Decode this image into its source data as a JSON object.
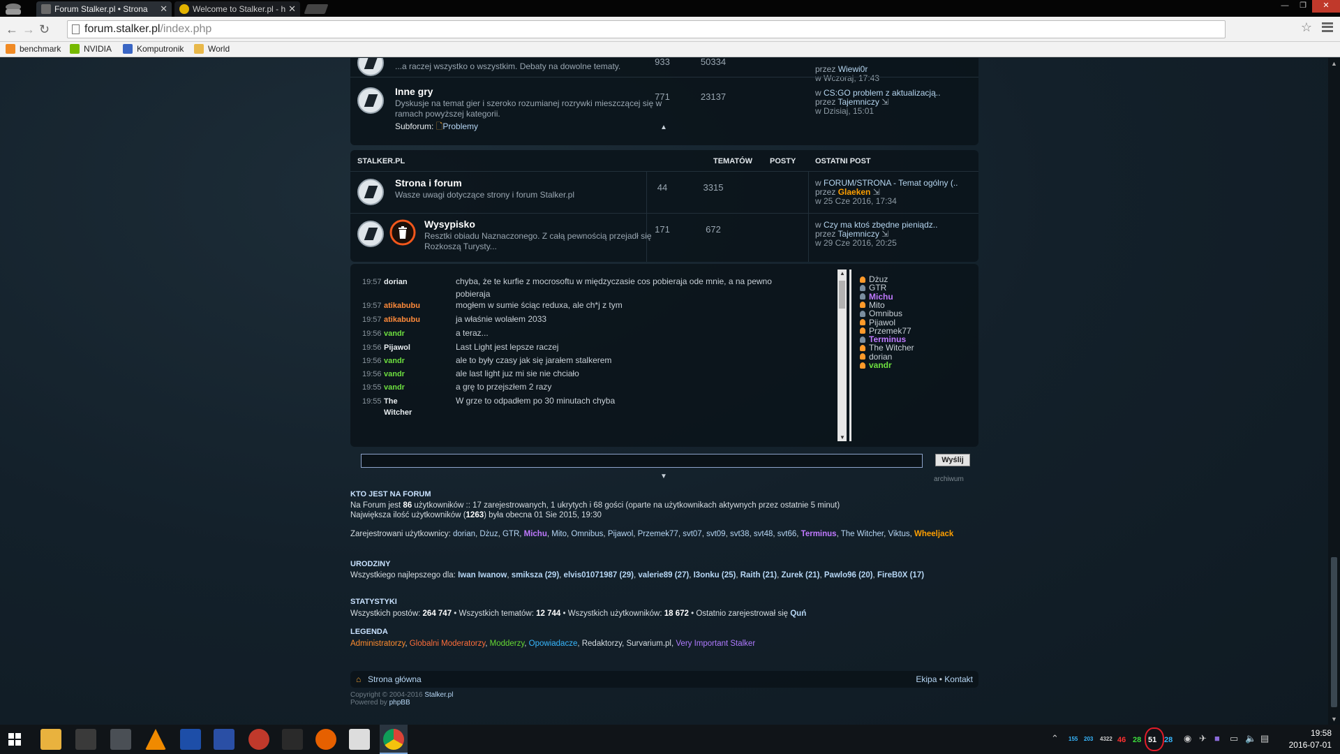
{
  "browser": {
    "tabs": [
      {
        "title": "Forum Stalker.pl • Strona",
        "active": true
      },
      {
        "title": "Welcome to Stalker.pl - h",
        "active": false
      }
    ],
    "url_host": "forum.stalker.pl",
    "url_path": "/index.php",
    "bookmarks": [
      "benchmark",
      "NVIDIA",
      "Komputronik",
      "World"
    ]
  },
  "forum": {
    "top_partial": {
      "desc": "...a raczej wszystko o wszystkim. Debaty na dowolne tematy.",
      "topics": "933",
      "posts": "50334",
      "last_by_label": "przez",
      "last_author": "Wiewi0r",
      "last_date": "w Wczoraj, 17:43"
    },
    "inne_gry": {
      "title": "Inne gry",
      "desc": "Dyskusje na temat gier i szeroko rozumianej rozrywki mieszczącej się w ramach powyższej kategorii.",
      "subforum_label": "Subforum:",
      "subforum_link": "Problemy",
      "topics": "771",
      "posts": "23137",
      "last_in": "w",
      "last_topic": "CS:GO problem z aktualizacją..",
      "last_by_label": "przez",
      "last_author": "Tajemniczy",
      "last_date": "w Dzisiaj, 15:01"
    },
    "section": {
      "name": "STALKER.PL",
      "col_topics": "TEMATÓW",
      "col_posts": "POSTY",
      "col_last": "OSTATNI POST"
    },
    "strona": {
      "title": "Strona i forum",
      "desc": "Wasze uwagi dotyczące strony i forum Stalker.pl",
      "topics": "44",
      "posts": "3315",
      "last_in": "w",
      "last_topic": "FORUM/STRONA - Temat ogólny (..",
      "last_by_label": "przez",
      "last_author": "Glaeken",
      "last_date": "w 25 Cze 2016, 17:34"
    },
    "wysypisko": {
      "title": "Wysypisko",
      "desc": "Resztki obiadu Naznaczonego. Z całą pewnością przejadł się Rozkoszą Turysty...",
      "topics": "171",
      "posts": "672",
      "last_in": "w",
      "last_topic": "Czy ma ktoś zbędne pieniądz..",
      "last_by_label": "przez",
      "last_author": "Tajemniczy",
      "last_date": "w 29 Cze 2016, 20:25"
    }
  },
  "chat": {
    "messages": [
      {
        "time": "19:57",
        "nick": "dorian",
        "cls": "nick-white",
        "text": "chyba, że te kurfie z mocrosoftu w międzyczasie cos pobieraja ode mnie, a na pewno pobieraja"
      },
      {
        "time": "19:57",
        "nick": "atikabubu",
        "cls": "nick-orange",
        "text": "mogłem w sumie ściąc reduxa, ale ch*j z tym"
      },
      {
        "time": "19:57",
        "nick": "atikabubu",
        "cls": "nick-orange",
        "text": "ja właśnie wolałem 2033"
      },
      {
        "time": "19:56",
        "nick": "vandr",
        "cls": "nick-green",
        "text": "a teraz..."
      },
      {
        "time": "19:56",
        "nick": "Pijawol",
        "cls": "nick-white",
        "text": "Last Light jest lepsze raczej"
      },
      {
        "time": "19:56",
        "nick": "vandr",
        "cls": "nick-green",
        "text": "ale to były czasy jak się jarałem stalkerem"
      },
      {
        "time": "19:56",
        "nick": "vandr",
        "cls": "nick-green",
        "text": "ale last light juz mi sie nie chciało"
      },
      {
        "time": "19:55",
        "nick": "vandr",
        "cls": "nick-green",
        "text": "a grę to przejszłem 2 razy"
      },
      {
        "time": "19:55",
        "nick": "The Witcher",
        "cls": "nick-white",
        "text": "W grze to odpadłem po 30 minutach chyba"
      }
    ],
    "online": [
      {
        "name": "Dżuz",
        "color": "#c8d0d7",
        "dot": "#ff9a2a",
        "bold": false
      },
      {
        "name": "GTR",
        "color": "#c8d0d7",
        "dot": "#7a8ea0",
        "bold": false
      },
      {
        "name": "Michu",
        "color": "#c079ff",
        "dot": "#7a8ea0",
        "bold": true
      },
      {
        "name": "Mito",
        "color": "#c8d0d7",
        "dot": "#ff9a2a",
        "bold": false
      },
      {
        "name": "Omnibus",
        "color": "#c8d0d7",
        "dot": "#7a8ea0",
        "bold": false
      },
      {
        "name": "Pijawol",
        "color": "#c8d0d7",
        "dot": "#ff9a2a",
        "bold": false
      },
      {
        "name": "Przemek77",
        "color": "#c8d0d7",
        "dot": "#ff9a2a",
        "bold": false
      },
      {
        "name": "Terminus",
        "color": "#c079ff",
        "dot": "#7a8ea0",
        "bold": true
      },
      {
        "name": "The Witcher",
        "color": "#c8d0d7",
        "dot": "#ff9a2a",
        "bold": false
      },
      {
        "name": "dorian",
        "color": "#c8d0d7",
        "dot": "#ff9a2a",
        "bold": false
      },
      {
        "name": "vandr",
        "color": "#6ddf3f",
        "dot": "#ff9a2a",
        "bold": true
      }
    ],
    "send_label": "Wyślij",
    "archive_label": "archiwum"
  },
  "who": {
    "head": "KTO JEST NA FORUM",
    "line1_a": "Na Forum jest ",
    "line1_count": "86",
    "line1_b": " użytkowników :: 17 zarejestrowanych, 1 ukrytych i 68 gości (oparte na użytkownikach aktywnych przez ostatnie 5 minut)",
    "line2_a": "Największa ilość użytkowników (",
    "line2_count": "1263",
    "line2_b": ") była obecna 01 Sie 2015, 19:30",
    "registered_label": "Zarejestrowani użytkownicy:",
    "registered_users": [
      "dorian",
      "Dżuz",
      "GTR",
      "Michu",
      "Mito",
      "Omnibus",
      "Pijawol",
      "Przemek77",
      "svt07",
      "svt09",
      "svt38",
      "svt48",
      "svt66",
      "Terminus",
      "The Witcher",
      "Viktus",
      "Wheeljack"
    ]
  },
  "birthdays": {
    "head": "URODZINY",
    "label": "Wszystkiego najlepszego dla:",
    "people": [
      "Iwan Iwanow",
      "smiksza (29)",
      "elvis01071987 (29)",
      "valerie89 (27)",
      "I3onku (25)",
      "Raith (21)",
      "Zurek (21)",
      "Pawlo96 (20)",
      "FireB0X (17)"
    ]
  },
  "stats": {
    "head": "STATYSTYKI",
    "posts_label": "Wszystkich postów:",
    "posts": "264 747",
    "topics_label": "Wszystkich tematów:",
    "topics": "12 744",
    "users_label": "Wszystkich użytkowników:",
    "users": "18 672",
    "newest_label": "Ostatnio zarejestrował się",
    "newest": "Quń"
  },
  "legend": {
    "head": "LEGENDA",
    "groups": [
      "Administratorzy",
      "Globalni Moderatorzy",
      "Modderzy",
      "Opowiadacze",
      "Redaktorzy",
      "Survarium.pl",
      "Very Important Stalker"
    ]
  },
  "footer": {
    "home": "Strona główna",
    "team": "Ekipa",
    "contact": "Kontakt",
    "copyright": "Copyright © 2004-2016",
    "site": "Stalker.pl",
    "powered": "Powered by",
    "phpbb": "phpBB"
  },
  "taskbar": {
    "tray_numbers": [
      "155",
      "203",
      "4322",
      "46",
      "28",
      "51",
      "28"
    ],
    "time": "19:58",
    "date": "2016-07-01"
  }
}
